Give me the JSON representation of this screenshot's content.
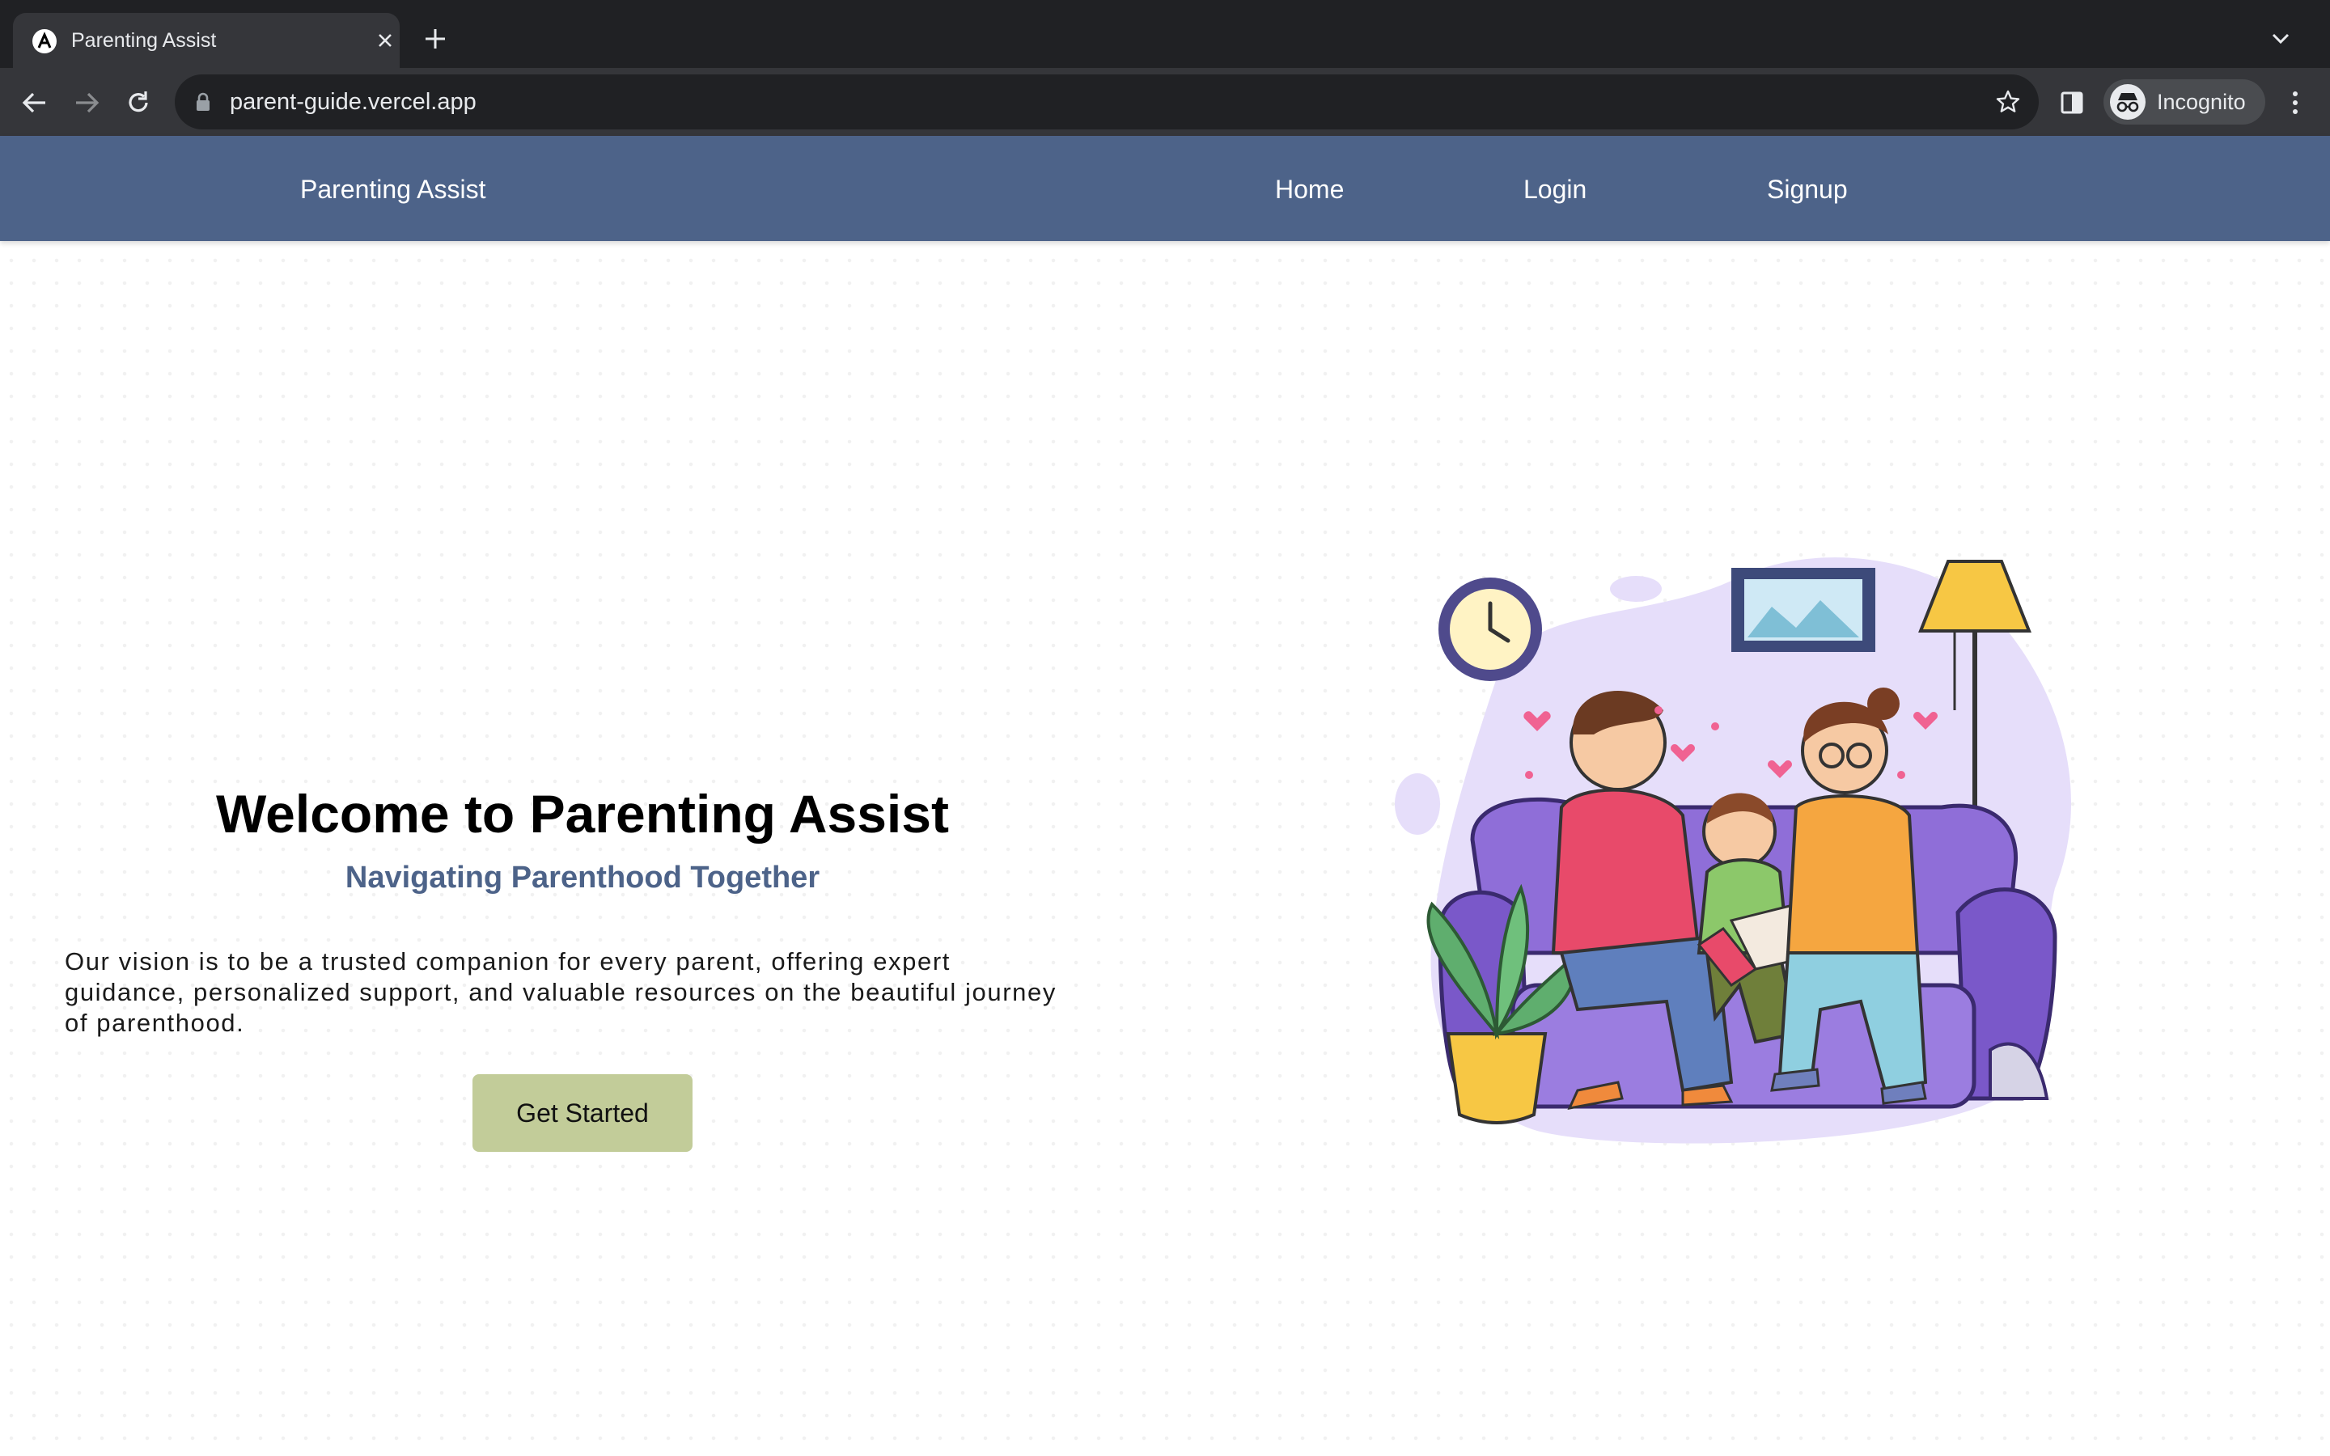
{
  "browser": {
    "tab_title": "Parenting Assist",
    "url": "parent-guide.vercel.app",
    "profile_label": "Incognito",
    "icons": [
      "app-favicon-icon",
      "close-icon",
      "plus-icon",
      "chevron-down-icon",
      "back-arrow-icon",
      "forward-arrow-icon",
      "reload-icon",
      "lock-icon",
      "star-icon",
      "side-panel-icon",
      "incognito-icon",
      "kebab-menu-icon"
    ]
  },
  "navbar": {
    "brand": "Parenting Assist",
    "links": [
      {
        "label": "Home"
      },
      {
        "label": "Login"
      },
      {
        "label": "Signup"
      }
    ],
    "background": "#4d6389"
  },
  "hero": {
    "title": "Welcome to Parenting Assist",
    "subtitle": "Navigating Parenthood Together",
    "description": "Our vision is to be a trusted companion for every parent, offering expert guidance, personalized support, and valuable resources on the beautiful journey of parenthood.",
    "cta_label": "Get Started",
    "cta_color": "#c2cc99",
    "subtitle_color": "#4d6389"
  }
}
